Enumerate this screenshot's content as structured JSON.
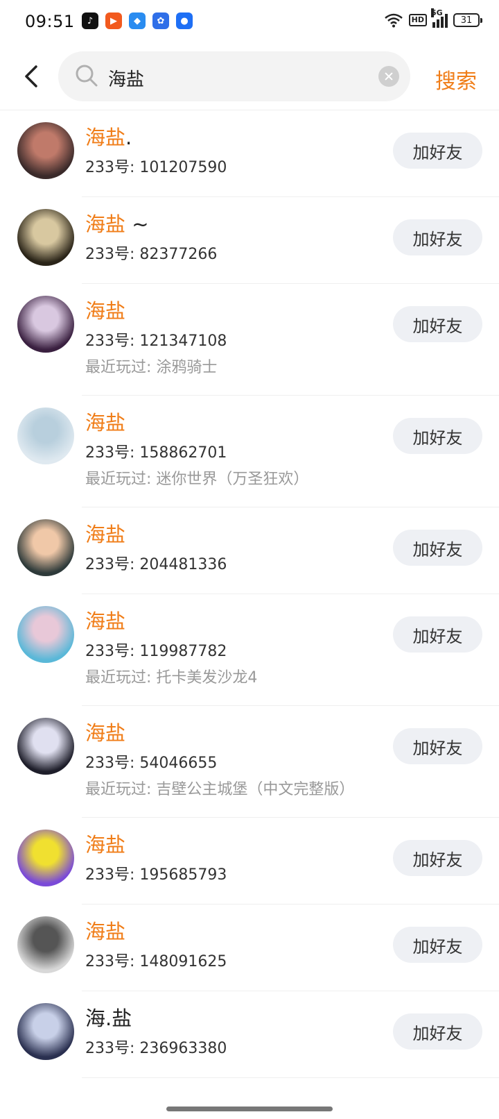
{
  "status_bar": {
    "time": "09:51",
    "network": "5G",
    "hd": "HD",
    "battery": "31",
    "apps": [
      {
        "icon": "tiktok-icon",
        "color": "#111111",
        "glyph": "♪"
      },
      {
        "icon": "kuaishou-icon",
        "color": "#f25a1e",
        "glyph": "▶"
      },
      {
        "icon": "blue-app-icon",
        "color": "#2a8cf0",
        "glyph": "◆"
      },
      {
        "icon": "baidu-icon",
        "color": "#2f6fe8",
        "glyph": "✿"
      },
      {
        "icon": "blue-circle-app-icon",
        "color": "#1e6ff5",
        "glyph": "●"
      }
    ]
  },
  "search": {
    "query": "海盐",
    "button_label": "搜索"
  },
  "results": [
    {
      "name_hl": "海盐",
      "name_rest": ".",
      "uid": "233号: 101207590",
      "recent": "",
      "btn": "加好友",
      "avatar": [
        "#3a2a2a",
        "#c07a6a"
      ]
    },
    {
      "name_hl": "海盐",
      "name_rest": " ~",
      "uid": "233号: 82377266",
      "recent": "",
      "btn": "加好友",
      "avatar": [
        "#2a2418",
        "#d8c8a0"
      ]
    },
    {
      "name_hl": "海盐",
      "name_rest": "",
      "uid": "233号: 121347108",
      "recent": "最近玩过: 涂鸦骑士",
      "btn": "加好友",
      "avatar": [
        "#3a2040",
        "#d9c8e0"
      ]
    },
    {
      "name_hl": "海盐",
      "name_rest": "",
      "uid": "233号: 158862701",
      "recent": "最近玩过: 迷你世界（万圣狂欢）",
      "btn": "加好友",
      "avatar": [
        "#dfe9f0",
        "#b8cfdd"
      ]
    },
    {
      "name_hl": "海盐",
      "name_rest": "",
      "uid": "233号: 204481336",
      "recent": "",
      "btn": "加好友",
      "avatar": [
        "#2e3a3a",
        "#f0c8a8"
      ]
    },
    {
      "name_hl": "海盐",
      "name_rest": "",
      "uid": "233号: 119987782",
      "recent": "最近玩过: 托卡美发沙龙4",
      "btn": "加好友",
      "avatar": [
        "#5ab8d8",
        "#e8c8d8"
      ]
    },
    {
      "name_hl": "海盐",
      "name_rest": "",
      "uid": "233号: 54046655",
      "recent": "最近玩过: 吉壁公主城堡（中文完整版）",
      "btn": "加好友",
      "avatar": [
        "#1e1e2a",
        "#e0e0f0"
      ]
    },
    {
      "name_hl": "海盐",
      "name_rest": "",
      "uid": "233号: 195685793",
      "recent": "",
      "btn": "加好友",
      "avatar": [
        "#7a4ad8",
        "#f0e030"
      ]
    },
    {
      "name_hl": "海盐",
      "name_rest": "",
      "uid": "233号: 148091625",
      "recent": "",
      "btn": "加好友",
      "avatar": [
        "#d8d8d8",
        "#555555"
      ]
    },
    {
      "name_hl": "",
      "name_rest": "海.盐",
      "uid": "233号: 236963380",
      "recent": "",
      "btn": "加好友",
      "avatar": [
        "#2a3050",
        "#c8d0e8"
      ]
    }
  ]
}
